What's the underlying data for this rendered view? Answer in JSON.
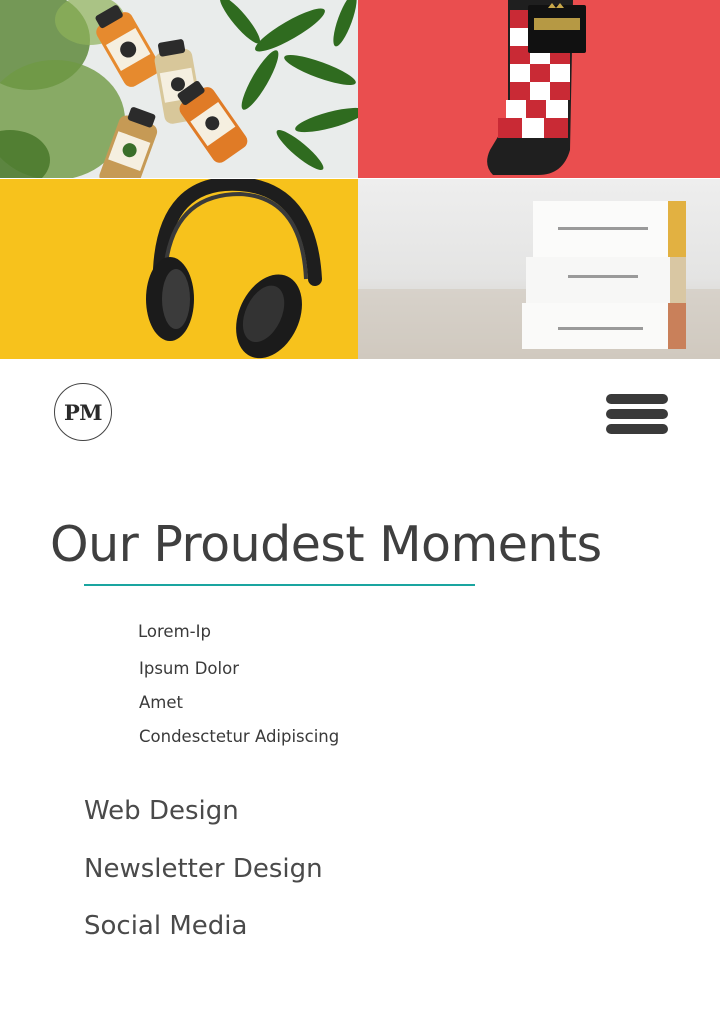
{
  "gallery": {
    "images": [
      {
        "name": "juice-bottles-photo"
      },
      {
        "name": "patterned-socks-photo"
      },
      {
        "name": "headphones-photo"
      },
      {
        "name": "soap-bars-photo"
      }
    ]
  },
  "header": {
    "logo_text": "PM",
    "menu_icon": "hamburger-menu-icon"
  },
  "section": {
    "title": "Our Proudest Moments",
    "accent_color": "#1aa5a0",
    "sub_items": [
      "Lorem-Ip",
      "Ipsum Dolor",
      "Amet",
      "Condesctetur Adipiscing"
    ],
    "main_items": [
      "Web Design",
      "Newsletter Design",
      "Social Media"
    ]
  }
}
